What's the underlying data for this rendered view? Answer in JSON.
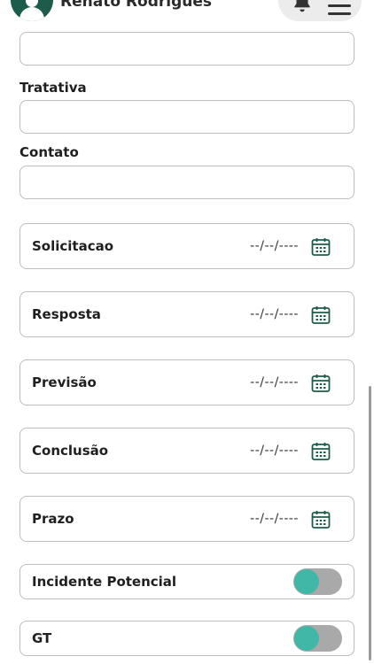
{
  "header": {
    "user_name": "Renato Rodrigues"
  },
  "form": {
    "tratativa_label": "Tratativa",
    "tratativa_value": "",
    "contato_label": "Contato",
    "contato_value": "",
    "top_field_value": "",
    "dates": [
      {
        "label": "Solicitacao",
        "value": "--/--/----"
      },
      {
        "label": "Resposta",
        "value": "--/--/----"
      },
      {
        "label": "Previsão",
        "value": "--/--/----"
      },
      {
        "label": "Conclusão",
        "value": "--/--/----"
      },
      {
        "label": "Prazo",
        "value": "--/--/----"
      }
    ],
    "toggles": [
      {
        "label": "Incidente Potencial",
        "on": false
      },
      {
        "label": "GT",
        "on": false
      }
    ]
  },
  "colors": {
    "brand": "#1d5b4b",
    "toggle_knob": "#3fb8a8",
    "toggle_track": "#a9a9a9",
    "field_border": "#bdbdbd"
  },
  "icons": {
    "notification": "bell-icon",
    "menu": "menu-icon",
    "date": "calendar-icon"
  }
}
